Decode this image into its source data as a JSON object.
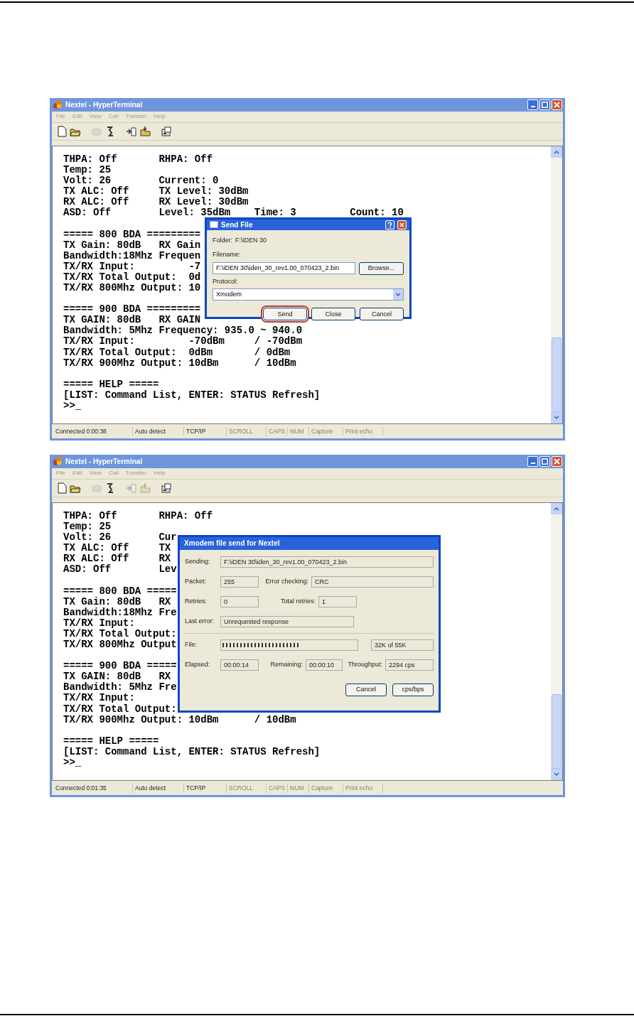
{
  "windows": [
    {
      "title": "Nextel - HyperTerminal",
      "menu": [
        "File",
        "Edit",
        "View",
        "Call",
        "Transfer",
        "Help"
      ],
      "toolbar": [
        {
          "kind": "new",
          "disabled": false
        },
        {
          "kind": "open",
          "disabled": false
        },
        {
          "kind": "call",
          "disabled": true
        },
        {
          "kind": "hangup",
          "disabled": false
        },
        {
          "kind": "send",
          "disabled": false
        },
        {
          "kind": "receive",
          "disabled": false
        },
        {
          "kind": "properties",
          "disabled": false
        }
      ],
      "terminal_blocks": [
        [
          "THPA: Off       RHPA: Off",
          "Temp: 25",
          "Volt: 26        Current: 0",
          "TX ALC: Off     TX Level: 30dBm",
          "RX ALC: Off     RX Level: 30dBm",
          "ASD: Off        Level: 35dBm    Time: 3         Count: 10"
        ],
        [
          "===== 800 BDA =========",
          "TX Gain: 80dB   RX Gain",
          "Bandwidth:18Mhz Frequen",
          "TX/RX Input:         -7",
          "TX/RX Total Output:  0d",
          "TX/RX 800Mhz Output: 10"
        ],
        [
          "===== 900 BDA =========",
          "TX GAIN: 80dB   RX GAIN",
          "Bandwidth: 5Mhz Frequency: 935.0 ~ 940.0",
          "TX/RX Input:         -70dBm     / -70dBm",
          "TX/RX Total Output:  0dBm       / 0dBm",
          "TX/RX 900Mhz Output: 10dBm      / 10dBm"
        ],
        [
          "===== HELP =====",
          "[LIST: Command List, ENTER: STATUS Refresh]",
          ">>_"
        ]
      ],
      "status_bar": [
        {
          "text": "Connected 0:00:38",
          "disabled": false
        },
        {
          "text": "Auto detect",
          "disabled": false
        },
        {
          "text": "TCP/IP",
          "disabled": false
        },
        {
          "text": "SCROLL",
          "disabled": true
        },
        {
          "text": "CAPS",
          "disabled": true
        },
        {
          "text": "NUM",
          "disabled": true
        },
        {
          "text": "Capture",
          "disabled": true
        },
        {
          "text": "Print echo",
          "disabled": true
        }
      ],
      "dialog": {
        "kind": "send_file",
        "title": "Send File",
        "folder_label": "Folder:",
        "folder": "F:\\iDEN 30",
        "filename_label": "Filename:",
        "filename": "F:\\iDEN 30\\iden_30_rev1.00_070423_2.bin",
        "browse": "Browse...",
        "protocol_label": "Protocol:",
        "protocol": "Xmodem",
        "buttons": [
          {
            "label": "Send",
            "highlighted": true
          },
          {
            "label": "Close",
            "highlighted": false
          },
          {
            "label": "Cancel",
            "highlighted": false
          }
        ]
      }
    },
    {
      "title": "Nextel - HyperTerminal",
      "menu": [
        "File",
        "Edit",
        "View",
        "Call",
        "Transfer",
        "Help"
      ],
      "toolbar": [
        {
          "kind": "new",
          "disabled": false
        },
        {
          "kind": "open",
          "disabled": false
        },
        {
          "kind": "call",
          "disabled": true
        },
        {
          "kind": "hangup",
          "disabled": false
        },
        {
          "kind": "send",
          "disabled": true
        },
        {
          "kind": "receive",
          "disabled": true
        },
        {
          "kind": "properties",
          "disabled": false
        }
      ],
      "terminal_blocks": [
        [
          "THPA: Off       RHPA: Off",
          "Temp: 25",
          "Volt: 26        Cur",
          "TX ALC: Off     TX",
          "RX ALC: Off     RX",
          "ASD: Off        Lev"
        ],
        [
          "===== 800 BDA =====",
          "TX Gain: 80dB   RX",
          "Bandwidth:18Mhz Fre",
          "TX/RX Input:",
          "TX/RX Total Output:",
          "TX/RX 800Mhz Output"
        ],
        [
          "===== 900 BDA =====",
          "TX GAIN: 80dB   RX",
          "Bandwidth: 5Mhz Fre",
          "TX/RX Input:",
          "TX/RX Total Output:",
          "TX/RX 900Mhz Output: 10dBm      / 10dBm"
        ],
        [
          "===== HELP =====",
          "[LIST: Command List, ENTER: STATUS Refresh]",
          ">>_"
        ]
      ],
      "status_bar": [
        {
          "text": "Connected 0:01:35",
          "disabled": false
        },
        {
          "text": "Auto detect",
          "disabled": false
        },
        {
          "text": "TCP/IP",
          "disabled": false
        },
        {
          "text": "SCROLL",
          "disabled": true
        },
        {
          "text": "CAPS",
          "disabled": true
        },
        {
          "text": "NUM",
          "disabled": true
        },
        {
          "text": "Capture",
          "disabled": true
        },
        {
          "text": "Print echo",
          "disabled": true
        }
      ],
      "dialog": {
        "kind": "xmodem_progress",
        "title": "Xmodem file send for Nextel",
        "sending": {
          "label": "Sending:",
          "value": "F:\\iDEN 30\\iden_30_rev1.00_070423_2.bin"
        },
        "packet": {
          "label": "Packet:",
          "value": "255"
        },
        "error_checking": {
          "label": "Error checking:",
          "value": "CRC"
        },
        "retries": {
          "label": "Retries:",
          "value": "0"
        },
        "total_retries": {
          "label": "Total retries:",
          "value": "1"
        },
        "last_error": {
          "label": "Last error:",
          "value": "Unrequested response"
        },
        "file": {
          "label": "File:",
          "level": 0.58,
          "value": "32K of 55K"
        },
        "elapsed": {
          "label": "Elapsed:",
          "value": "00:00:14"
        },
        "remaining": {
          "label": "Remaining:",
          "value": "00:00:10"
        },
        "throughput": {
          "label": "Throughput:",
          "value": "2294 cps"
        },
        "buttons": [
          "Cancel",
          "cps/bps"
        ]
      }
    }
  ]
}
